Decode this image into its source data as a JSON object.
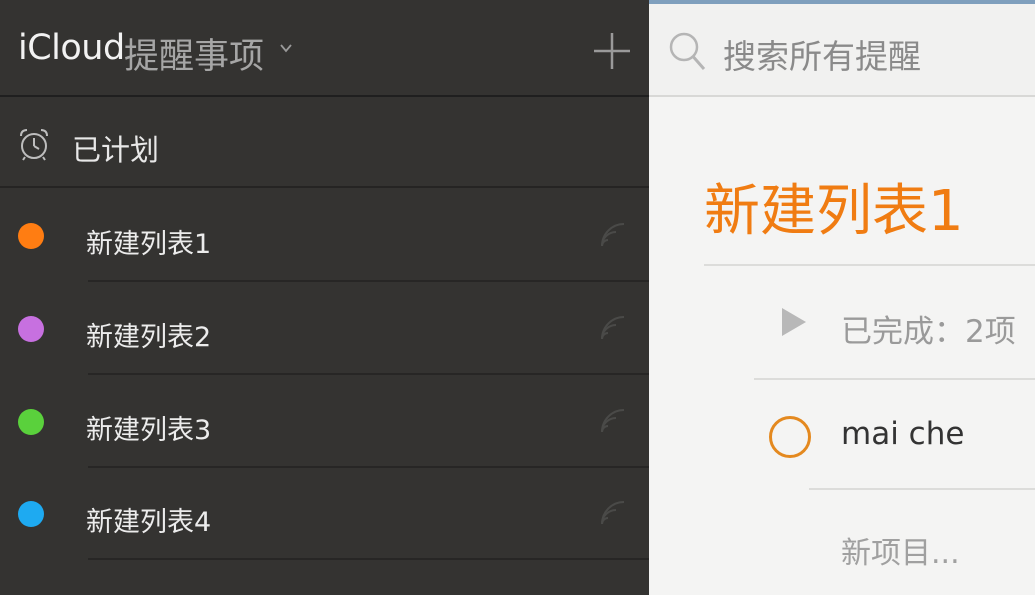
{
  "header": {
    "brand": "iCloud",
    "section": "提醒事项"
  },
  "sidebar": {
    "scheduled_label": "已计划",
    "lists": [
      {
        "label": "新建列表1",
        "color": "#ff7d12"
      },
      {
        "label": "新建列表2",
        "color": "#c770e0"
      },
      {
        "label": "新建列表3",
        "color": "#5ad13c"
      },
      {
        "label": "新建列表4",
        "color": "#1eaaf1"
      }
    ]
  },
  "search": {
    "placeholder": "搜索所有提醒"
  },
  "main": {
    "list_title": "新建列表1",
    "completed_label": "已完成：2项",
    "todos": [
      {
        "label": "mai che"
      }
    ],
    "new_item_placeholder": "新项目..."
  },
  "colors": {
    "accent": "#f07c12",
    "sidebar_bg": "#343331"
  }
}
